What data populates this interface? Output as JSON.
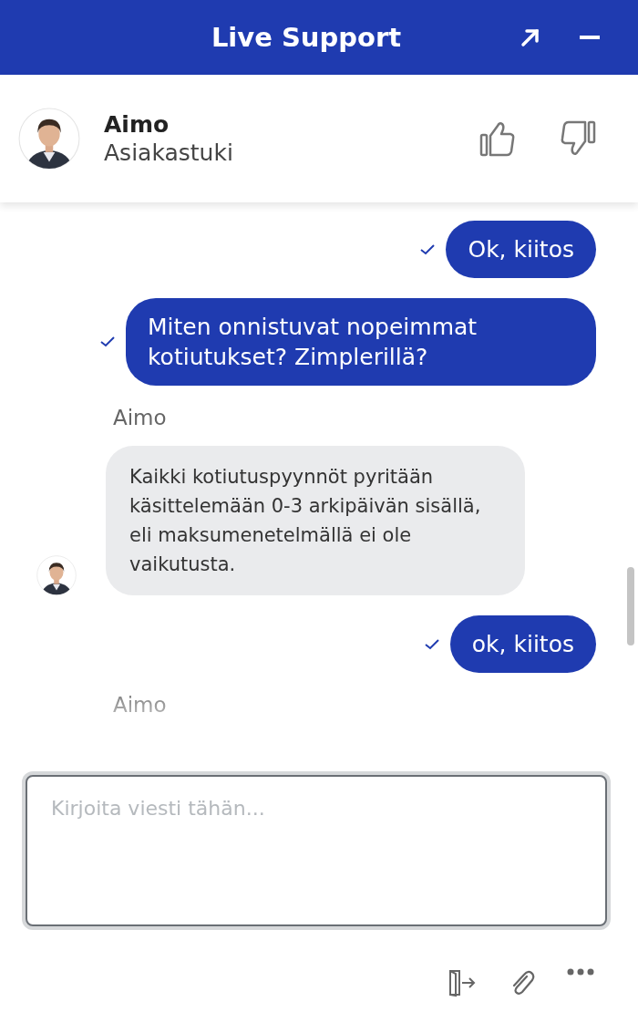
{
  "window": {
    "title": "Live Support",
    "buttons": [
      {
        "kind": "expand"
      },
      {
        "kind": "minimize"
      }
    ]
  },
  "agent": {
    "name": "Aimo",
    "role": "Asiakastuki",
    "rating_buttons": [
      {
        "kind": "like"
      },
      {
        "kind": "dislike"
      }
    ]
  },
  "messages": [
    {
      "kind": "sent",
      "text": "Ok, kiitos",
      "delivered": true
    },
    {
      "kind": "sent",
      "text": "Miten onnistuvat nopeimmat kotiutukset? Zimplerillä?",
      "delivered": true
    },
    {
      "kind": "sender",
      "text": "Aimo"
    },
    {
      "kind": "received",
      "text": "Kaikki kotiutuspyynnöt pyritään käsittelemään 0-3 arkipäivän sisällä, eli maksumenetelmällä ei ole vaikutusta."
    },
    {
      "kind": "sent",
      "text": "ok, kiitos",
      "delivered": true
    },
    {
      "kind": "sender",
      "text": "Aimo"
    }
  ],
  "composer": {
    "placeholder": "Kirjoita viesti tähän...",
    "actions": [
      {
        "kind": "end-chat"
      },
      {
        "kind": "attach"
      },
      {
        "kind": "more"
      }
    ]
  }
}
